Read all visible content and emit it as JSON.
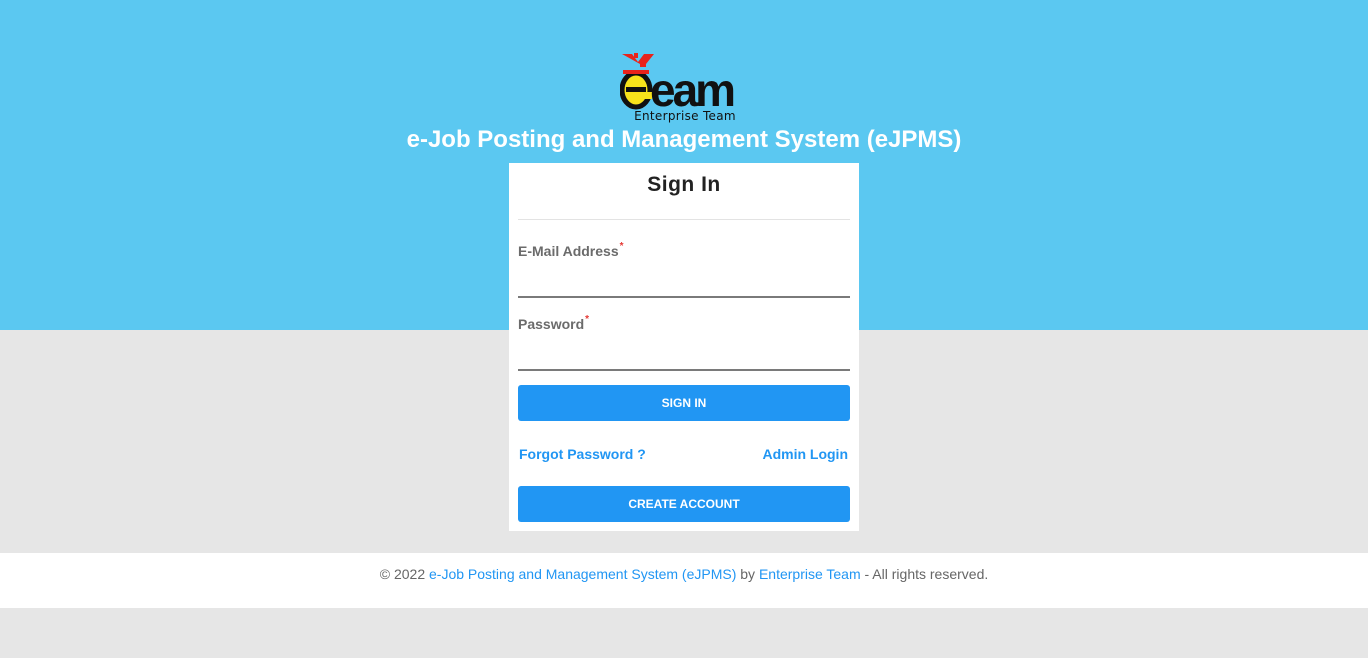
{
  "header": {
    "logo_text": "eTeam",
    "logo_subtitle": "Enterprise Team",
    "app_title": "e-Job Posting and Management System (eJPMS)"
  },
  "login_card": {
    "title": "Sign In",
    "email_label": "E-Mail Address",
    "email_value": "",
    "password_label": "Password",
    "password_value": "",
    "required_marker": "*",
    "sign_in_button": "SIGN IN",
    "forgot_password_link": "Forgot Password ?",
    "admin_login_link": "Admin Login",
    "create_account_button": "CREATE ACCOUNT"
  },
  "footer": {
    "prefix": "© 2022",
    "system_link": "e-Job Posting and Management System (eJPMS)",
    "by_text": "by",
    "team_link": "Enterprise Team",
    "suffix": "- All rights reserved."
  },
  "colors": {
    "hero_background": "#5bc8f1",
    "page_background": "#e6e6e6",
    "primary_button": "#2196f3",
    "link": "#2196f3",
    "required_marker": "#e53935",
    "logo_red": "#e8231b",
    "logo_yellow": "#f7e31b"
  }
}
